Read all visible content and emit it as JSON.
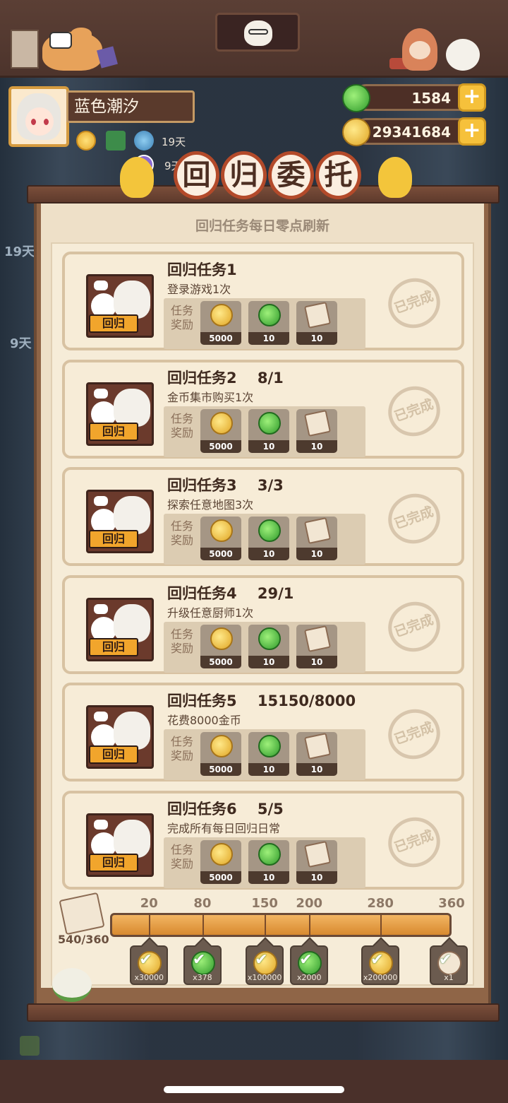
{
  "header": {
    "player_name": "蓝色潮汐",
    "status_days": [
      "19天",
      "9天"
    ],
    "side_days": [
      "19天",
      "9天"
    ]
  },
  "currencies": {
    "green": "1584",
    "gold": "29341684",
    "plus": "+"
  },
  "title": {
    "chars": [
      "回",
      "归",
      "委",
      "托"
    ],
    "subtitle": "回归任务每日零点刷新"
  },
  "tasks": [
    {
      "title": "回归任务1",
      "progress": "",
      "desc": "登录游戏1次",
      "tag": "回归",
      "reward_label": "任务奖励",
      "rewards": [
        "5000",
        "10",
        "10"
      ],
      "stamp": "已完成"
    },
    {
      "title": "回归任务2",
      "progress": "8/1",
      "desc": "金币集市购买1次",
      "tag": "回归",
      "reward_label": "任务奖励",
      "rewards": [
        "5000",
        "10",
        "10"
      ],
      "stamp": "已完成"
    },
    {
      "title": "回归任务3",
      "progress": "3/3",
      "desc": "探索任意地图3次",
      "tag": "回归",
      "reward_label": "任务奖励",
      "rewards": [
        "5000",
        "10",
        "10"
      ],
      "stamp": "已完成"
    },
    {
      "title": "回归任务4",
      "progress": "29/1",
      "desc": "升级任意厨师1次",
      "tag": "回归",
      "reward_label": "任务奖励",
      "rewards": [
        "5000",
        "10",
        "10"
      ],
      "stamp": "已完成"
    },
    {
      "title": "回归任务5",
      "progress": "15150/8000",
      "desc": "花费8000金币",
      "tag": "回归",
      "reward_label": "任务奖励",
      "rewards": [
        "5000",
        "10",
        "10"
      ],
      "stamp": "已完成"
    },
    {
      "title": "回归任务6",
      "progress": "5/5",
      "desc": "完成所有每日回归日常",
      "tag": "回归",
      "reward_label": "任务奖励",
      "rewards": [
        "5000",
        "10",
        "10"
      ],
      "stamp": "已完成"
    }
  ],
  "progress": {
    "count": "540/360",
    "current": 540,
    "max": 360,
    "milestones": [
      {
        "value": 20,
        "label": "20",
        "reward": "x30000",
        "icon": "coin-icon"
      },
      {
        "value": 80,
        "label": "80",
        "reward": "x378",
        "icon": "gem-icon"
      },
      {
        "value": 150,
        "label": "150",
        "reward": "x100000",
        "icon": "coin-icon"
      },
      {
        "value": 200,
        "label": "200",
        "reward": "x2000",
        "icon": "gem-icon"
      },
      {
        "value": 280,
        "label": "280",
        "reward": "x200000",
        "icon": "coin-icon"
      },
      {
        "value": 360,
        "label": "360",
        "reward": "x1",
        "icon": "scroll-icon"
      }
    ]
  },
  "colors": {
    "gold": "#e0a524",
    "green": "#2f9a2b",
    "panel": "#f6ecd8",
    "accent": "#b34a2a"
  }
}
